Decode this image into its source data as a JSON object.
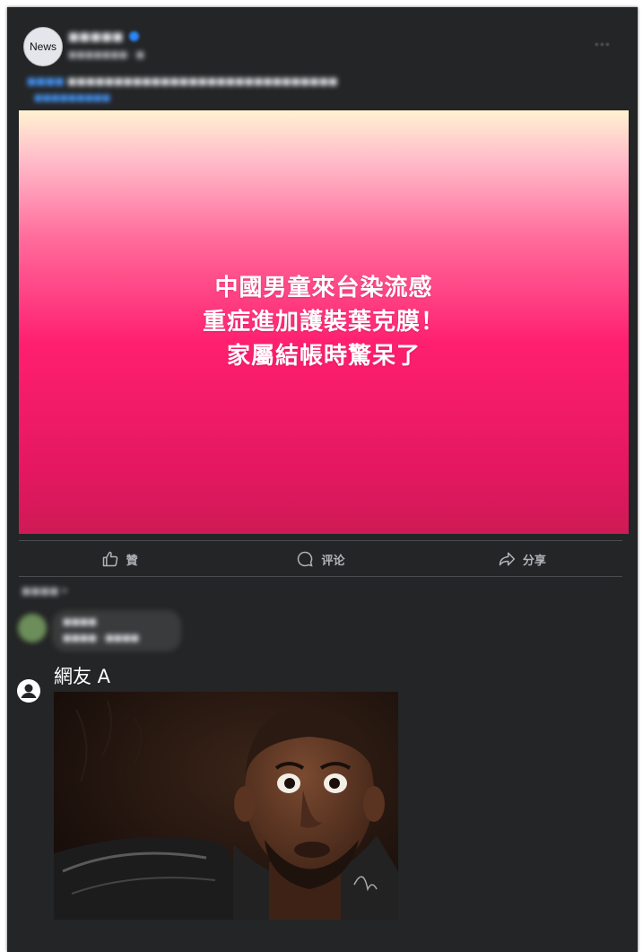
{
  "post": {
    "avatar_text": "News",
    "page_name": "■■■■■",
    "meta": "■■■■■■■ · ■",
    "more": "···",
    "caption_tag": "■■■■",
    "caption_text": "■■■■■■■■■■■■■■■■■■■■■■■■■■■■■",
    "caption_link": "■■■■■■■■■"
  },
  "banner": {
    "line1": "中國男童來台染流感",
    "line2": "重症進加護裝葉克膜！",
    "line3": "家屬結帳時驚呆了"
  },
  "actions": {
    "like": "贊",
    "comment": "评论",
    "share": "分享"
  },
  "comments": {
    "sort_label": "■■■■ ▾",
    "commenter_name": "■■■■",
    "commenter_text": "■■■■ · ■■■■"
  },
  "reply": {
    "user_name": "網友 A",
    "image_icon": "surprised-man-meme"
  },
  "colors": {
    "card_bg": "#242526",
    "banner_top": "#fff2d2",
    "banner_mid": "#ff1f6f",
    "link": "#4599ff"
  }
}
